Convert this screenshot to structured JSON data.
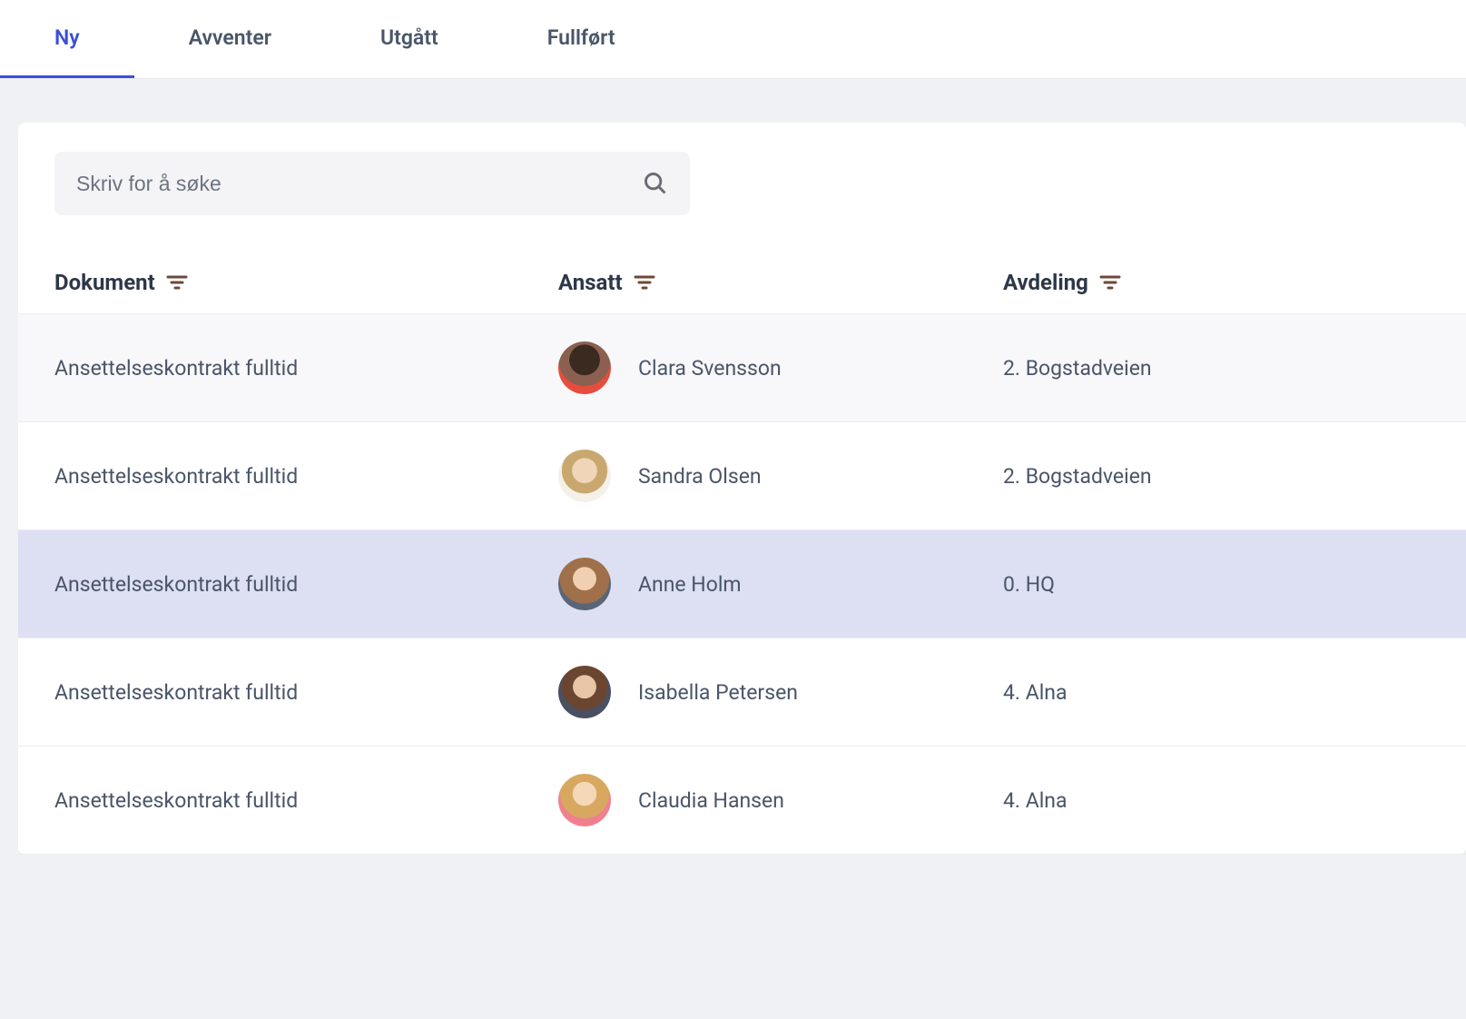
{
  "tabs": [
    {
      "label": "Ny",
      "active": true
    },
    {
      "label": "Avventer",
      "active": false
    },
    {
      "label": "Utgått",
      "active": false
    },
    {
      "label": "Fullført",
      "active": false
    }
  ],
  "search": {
    "placeholder": "Skriv for å søke",
    "value": ""
  },
  "columns": {
    "document": "Dokument",
    "employee": "Ansatt",
    "department": "Avdeling"
  },
  "rows": [
    {
      "document": "Ansettelseskontrakt fulltid",
      "employee": "Clara Svensson",
      "department": "2. Bogstadveien",
      "highlight": false,
      "alt": true
    },
    {
      "document": "Ansettelseskontrakt fulltid",
      "employee": "Sandra Olsen",
      "department": "2. Bogstadveien",
      "highlight": false,
      "alt": false
    },
    {
      "document": "Ansettelseskontrakt fulltid",
      "employee": "Anne Holm",
      "department": "0. HQ",
      "highlight": true,
      "alt": false
    },
    {
      "document": "Ansettelseskontrakt fulltid",
      "employee": "Isabella Petersen",
      "department": "4. Alna",
      "highlight": false,
      "alt": false
    },
    {
      "document": "Ansettelseskontrakt fulltid",
      "employee": "Claudia Hansen",
      "department": "4. Alna",
      "highlight": false,
      "alt": false
    }
  ]
}
